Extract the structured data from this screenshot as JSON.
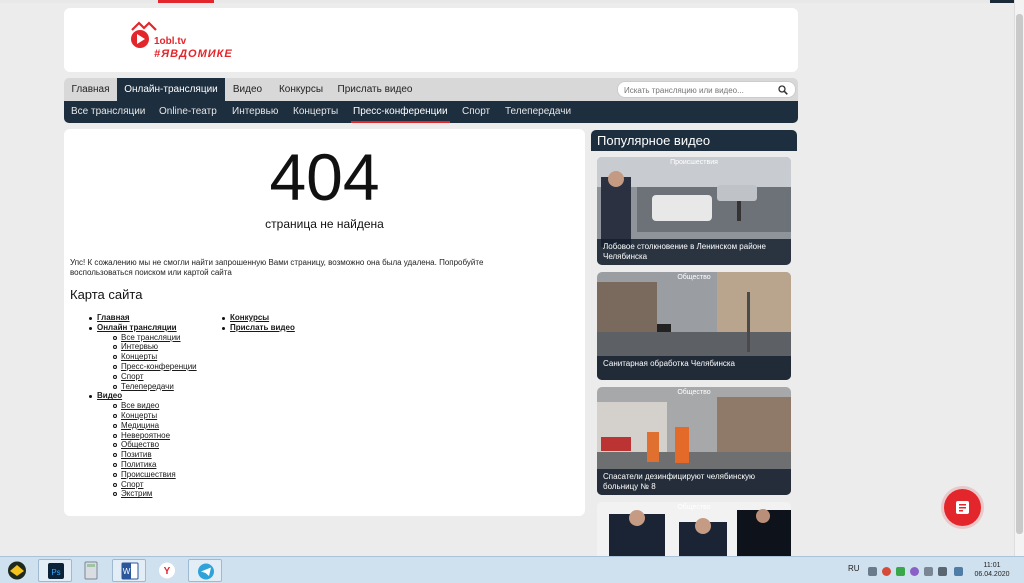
{
  "brand": {
    "site": "1obl.tv",
    "tag": "#ЯВДОМИКЕ"
  },
  "nav_main": [
    {
      "label": "Главная",
      "active": false
    },
    {
      "label": "Онлайн-трансляции",
      "active": true
    },
    {
      "label": "Видео",
      "active": false
    },
    {
      "label": "Конкурсы",
      "active": false
    },
    {
      "label": "Прислать видео",
      "active": false
    }
  ],
  "search": {
    "placeholder": "Искать трансляцию или видео...",
    "icon": "search-icon"
  },
  "nav_sub": [
    {
      "label": "Все трансляции",
      "active": false
    },
    {
      "label": "Online-театр",
      "active": false
    },
    {
      "label": "Интервью",
      "active": false
    },
    {
      "label": "Концерты",
      "active": false
    },
    {
      "label": "Пресс-конференции",
      "active": true
    },
    {
      "label": "Спорт",
      "active": false
    },
    {
      "label": "Телепередачи",
      "active": false
    }
  ],
  "error": {
    "code": "404",
    "title": "страница не найдена",
    "message": "Упс! К сожалению мы не смогли найти запрошенную Вами страницу, возможно она была удалена. Попробуйте воспользоваться поиском или картой сайта"
  },
  "sitemap": {
    "title": "Карта сайта",
    "col1": {
      "home": "Главная",
      "live": "Онлайн трансляции",
      "live_items": [
        "Все трансляции",
        "Интервью",
        "Концерты",
        "Пресс-конференции",
        "Спорт",
        "Телепередачи"
      ],
      "video": "Видео",
      "video_items": [
        "Все видео",
        "Концерты",
        "Медицина",
        "Невероятное",
        "Общество",
        "Позитив",
        "Политика",
        "Происшествия",
        "Спорт",
        "Экстрим"
      ]
    },
    "col2": [
      "Конкурсы",
      "Прислать видео"
    ]
  },
  "popular": {
    "title": "Популярное видео",
    "cards": [
      {
        "category": "Происшествия",
        "caption": "Лобовое столкновение в Ленинском районе Челябинска"
      },
      {
        "category": "Общество",
        "caption": "Санитарная обработка Челябинска"
      },
      {
        "category": "Общество",
        "caption": "Спасатели дезинфицируют челябинскую больницу № 8"
      },
      {
        "category": "Общество",
        "caption": ""
      }
    ]
  },
  "fab": {
    "icon": "chat-icon"
  },
  "taskbar": {
    "lang": "RU",
    "time": "11:01",
    "date": "06.04.2020",
    "apps": [
      "windows-start-icon",
      "photoshop-icon",
      "calculator-icon",
      "word-icon",
      "yandex-browser-icon",
      "telegram-icon"
    ]
  },
  "colors": {
    "accent": "#e3262b",
    "nav_dark": "#1d2e3e"
  }
}
